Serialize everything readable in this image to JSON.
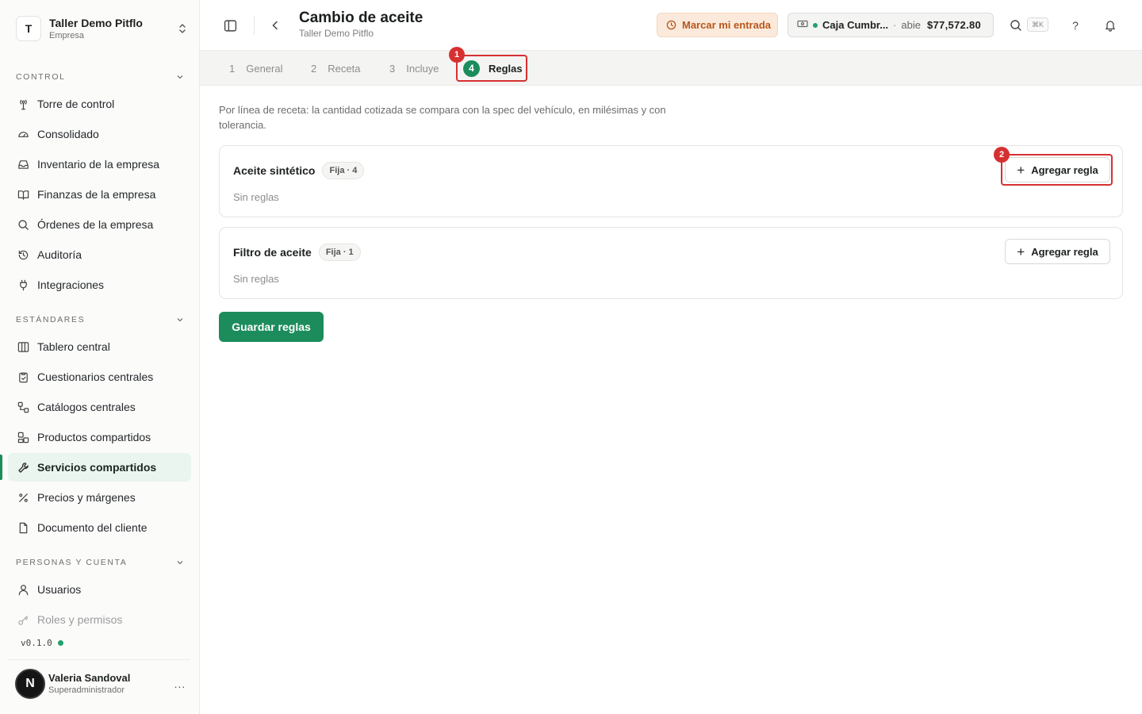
{
  "org": {
    "initial": "T",
    "name": "Taller Demo Pitflo",
    "sub": "Empresa"
  },
  "sections": {
    "control": "CONTROL",
    "estandares": "ESTÁNDARES",
    "personas": "PERSONAS Y CUENTA"
  },
  "nav": {
    "torre": "Torre de control",
    "consolidado": "Consolidado",
    "inventario": "Inventario de la empresa",
    "finanzas": "Finanzas de la empresa",
    "ordenes": "Órdenes de la empresa",
    "auditoria": "Auditoría",
    "integraciones": "Integraciones",
    "tablero": "Tablero central",
    "cuestionarios": "Cuestionarios centrales",
    "catalogos": "Catálogos centrales",
    "productos": "Productos compartidos",
    "servicios": "Servicios compartidos",
    "precios": "Precios y márgenes",
    "documento": "Documento del cliente",
    "usuarios": "Usuarios",
    "roles": "Roles y permisos"
  },
  "version": "v0.1.0",
  "user": {
    "initial": "N",
    "name": "Valeria Sandoval",
    "role": "Superadministrador",
    "more": "..."
  },
  "page": {
    "title": "Cambio de aceite",
    "subtitle": "Taller Demo Pitflo"
  },
  "topbar": {
    "clockin_label": "Marcar mi entrada",
    "cash_name": "Caja Cumbr...",
    "cash_sep": "·",
    "cash_status": "abie",
    "cash_amount": "$77,572.80",
    "shortcut": "⌘K",
    "help": "?"
  },
  "steps": [
    {
      "num": "1",
      "label": "General"
    },
    {
      "num": "2",
      "label": "Receta"
    },
    {
      "num": "3",
      "label": "Incluye"
    },
    {
      "num": "4",
      "label": "Reglas"
    }
  ],
  "annotations": {
    "badge1": "1",
    "badge2": "2"
  },
  "description": "Por línea de receta: la cantidad cotizada se compara con la spec del vehículo, en milésimas y con tolerancia.",
  "rules": [
    {
      "name": "Aceite sintético",
      "pill": "Fija · 4",
      "empty": "Sin reglas",
      "add_label": "Agregar regla"
    },
    {
      "name": "Filtro de aceite",
      "pill": "Fija · 1",
      "empty": "Sin reglas",
      "add_label": "Agregar regla"
    }
  ],
  "save_label": "Guardar reglas",
  "colors": {
    "accent": "#1c8c5c",
    "highlight": "#d63031",
    "warning_bg": "#fbeadb",
    "warning_text": "#b8561b"
  }
}
